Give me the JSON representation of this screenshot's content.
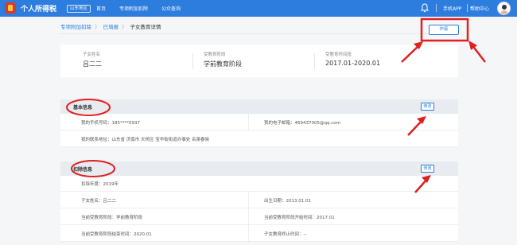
{
  "header": {
    "app_title": "个人所得税",
    "region": "山东地区",
    "nav": [
      "首页",
      "专项附加扣除",
      "公众查询"
    ],
    "icons": [
      "bell-icon"
    ],
    "links": [
      "手机APP",
      "帮助中心"
    ]
  },
  "breadcrumb": {
    "root": "专项附加扣除",
    "middle": "已填报",
    "current": "子女教育详情",
    "separator": "〉"
  },
  "void_button": "作废",
  "summary": [
    {
      "label": "子女姓名",
      "value": "吕二二"
    },
    {
      "label": "受教育阶段",
      "value": "学前教育阶段"
    },
    {
      "label": "受教育时间段",
      "value": "2017.01-2020.01"
    }
  ],
  "basic_info": {
    "title": "基本信息",
    "edit": "修改",
    "phone": "我的手机号码：185****0937",
    "email": "我的电子邮箱：469437005@qq.com",
    "address": "我的联系地址：山东省 济南市 天桥区 宝华街街道办事处 名泉春晓"
  },
  "deduction_info": {
    "title": "扣除信息",
    "edit": "修改",
    "year": "扣除年度：2019年",
    "child_name": "子女姓名：吕二二",
    "birth": "出生日期：2013.01.01",
    "stage": "当前受教育阶段：学前教育阶段",
    "stage_start": "当前受教育阶段开始时间：2017.01",
    "stage_end": "当前受教育阶段结束时间：2020.01",
    "edu_stop": "子女教育终止时间：--"
  },
  "colors": {
    "header_blue": "#2d7dde",
    "annotation_red": "#e02020"
  }
}
